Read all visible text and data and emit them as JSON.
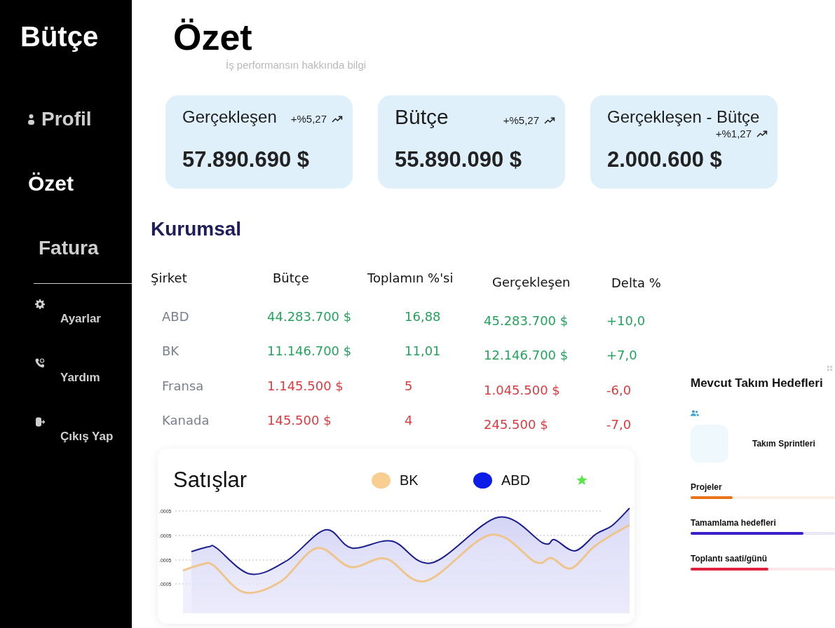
{
  "sidebar": {
    "brand": "Bütçe",
    "items": [
      {
        "label": "Profil",
        "selected": false
      },
      {
        "label": "Özet",
        "selected": true
      },
      {
        "label": "Fatura",
        "selected": false
      }
    ],
    "secondary_items": [
      {
        "label": "Ayarlar"
      },
      {
        "label": "Yardım"
      },
      {
        "label": "Çıkış Yap"
      }
    ]
  },
  "header": {
    "title": "Özet",
    "subtitle": "İş performansın hakkında bilgi"
  },
  "cards": [
    {
      "label": "Gerçekleşen",
      "change": "+%5,27",
      "value": "57.890.690 $"
    },
    {
      "label": "Bütçe",
      "change": "+%5,27",
      "value": "55.890.090 $"
    },
    {
      "label": "Gerçekleşen - Bütçe",
      "change": "+%1,27",
      "value": "2.000.600 $"
    }
  ],
  "corporate": {
    "title": "Kurumsal",
    "columns": [
      "Şirket",
      "Bütçe",
      "Toplamın %'si",
      "Gerçekleşen",
      "Delta %"
    ],
    "rows": [
      {
        "company": "ABD",
        "budget": "44.283.700 $",
        "share": "16,88",
        "actual": "45.283.700 $",
        "delta": "+10,0",
        "positive": true
      },
      {
        "company": "BK",
        "budget": "11.146.700 $",
        "share": "11,01",
        "actual": "12.146.700 $",
        "delta": "+7,0",
        "positive": true
      },
      {
        "company": "Fransa",
        "budget": "1.145.500 $",
        "share": "5",
        "actual": "1.045.500 $",
        "delta": "-6,0",
        "positive": false
      },
      {
        "company": "Kanada",
        "budget": "145.500 $",
        "share": "4",
        "actual": "245.500 $",
        "delta": "-7,0",
        "positive": false
      }
    ]
  },
  "sales": {
    "title": "Satışlar",
    "legend": [
      {
        "kind": "dot",
        "label": "BK",
        "color": "#f8cf90"
      },
      {
        "kind": "dot",
        "label": "ABD",
        "color": "#0b1de6"
      },
      {
        "kind": "star",
        "color": "#5ce64b"
      }
    ],
    "axis_labels": [
      ".0005",
      ".0005",
      ".0005",
      ".0005"
    ]
  },
  "team_goals": {
    "title": "Mevcut Takım Hedefleri",
    "sprint_label": "Takım Sprintleri",
    "goals": [
      {
        "label": "Projeler",
        "level": 0.29,
        "color": "#e8731a"
      },
      {
        "label": "Tamamlama hedefleri",
        "level": 0.78,
        "color": "#3b1fc9"
      },
      {
        "label": "Toplantı saati/günü",
        "level": 0.54,
        "color": "#e0203c"
      }
    ]
  }
}
